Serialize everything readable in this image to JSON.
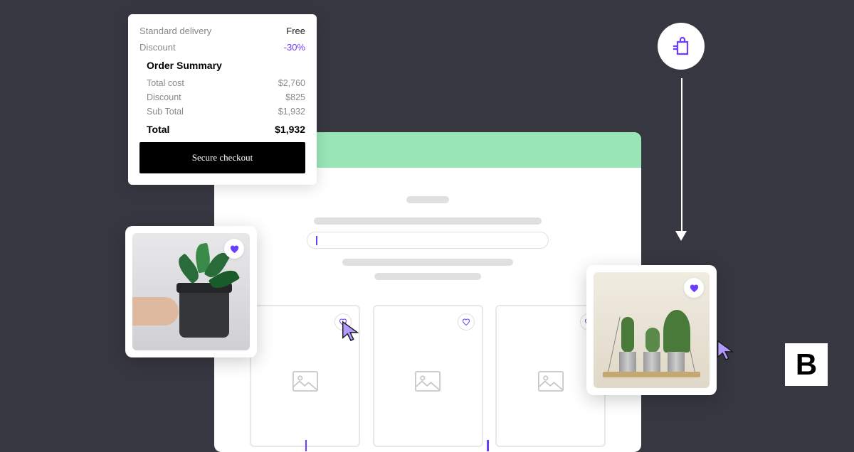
{
  "order_card": {
    "delivery_label": "Standard delivery",
    "delivery_value": "Free",
    "discount_label": "Discount",
    "discount_value": "-30%",
    "summary_title": "Order Summary",
    "rows": [
      {
        "label": "Total cost",
        "value": "$2,760"
      },
      {
        "label": "Discount",
        "value": "$825"
      },
      {
        "label": "Sub Total",
        "value": "$1,932"
      }
    ],
    "total_label": "Total",
    "total_value": "$1,932",
    "checkout_label": "Secure checkout"
  },
  "logo": {
    "letter": "B"
  },
  "colors": {
    "accent_purple": "#6c3dff",
    "mint_header": "#98e6b6",
    "dark_bg": "#363740"
  }
}
